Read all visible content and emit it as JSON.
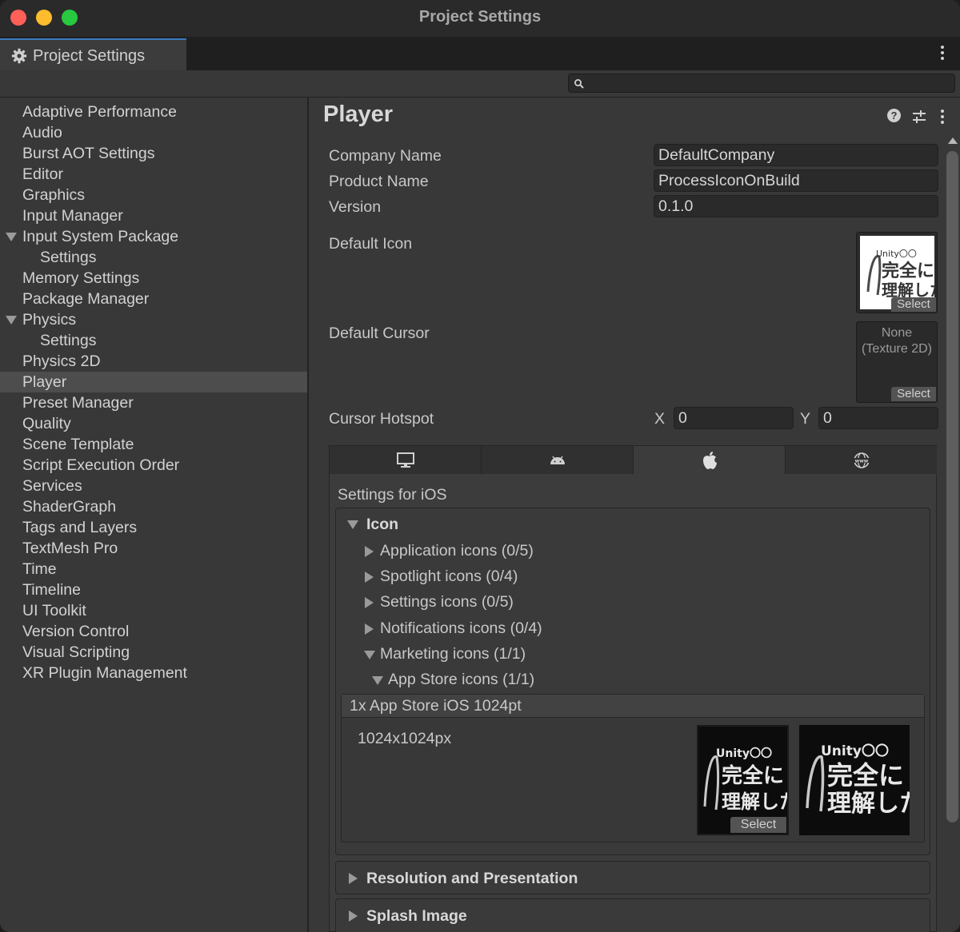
{
  "window": {
    "title": "Project Settings"
  },
  "tab": {
    "label": "Project Settings",
    "icon": "gear-icon"
  },
  "search": {
    "placeholder": ""
  },
  "sidebar": {
    "items": [
      {
        "label": "Adaptive Performance"
      },
      {
        "label": "Audio"
      },
      {
        "label": "Burst AOT Settings"
      },
      {
        "label": "Editor"
      },
      {
        "label": "Graphics"
      },
      {
        "label": "Input Manager"
      },
      {
        "label": "Input System Package"
      },
      {
        "label": "Settings"
      },
      {
        "label": "Memory Settings"
      },
      {
        "label": "Package Manager"
      },
      {
        "label": "Physics"
      },
      {
        "label": "Settings"
      },
      {
        "label": "Physics 2D"
      },
      {
        "label": "Player"
      },
      {
        "label": "Preset Manager"
      },
      {
        "label": "Quality"
      },
      {
        "label": "Scene Template"
      },
      {
        "label": "Script Execution Order"
      },
      {
        "label": "Services"
      },
      {
        "label": "ShaderGraph"
      },
      {
        "label": "Tags and Layers"
      },
      {
        "label": "TextMesh Pro"
      },
      {
        "label": "Time"
      },
      {
        "label": "Timeline"
      },
      {
        "label": "UI Toolkit"
      },
      {
        "label": "Version Control"
      },
      {
        "label": "Visual Scripting"
      },
      {
        "label": "XR Plugin Management"
      }
    ],
    "selected": "Player"
  },
  "player": {
    "title": "Player",
    "company_name": {
      "label": "Company Name",
      "value": "DefaultCompany"
    },
    "product_name": {
      "label": "Product Name",
      "value": "ProcessIconOnBuild"
    },
    "version": {
      "label": "Version",
      "value": "0.1.0"
    },
    "default_icon": {
      "label": "Default Icon",
      "select": "Select",
      "art": {
        "line1": "Unity〇〇",
        "line2": "完全に",
        "line3": "理解した"
      }
    },
    "default_cursor": {
      "label": "Default Cursor",
      "none_line1": "None",
      "none_line2": "(Texture 2D)",
      "select": "Select"
    },
    "cursor_hotspot": {
      "label": "Cursor Hotspot",
      "x_label": "X",
      "x": "0",
      "y_label": "Y",
      "y": "0"
    }
  },
  "platform_tabs": [
    "desktop-icon",
    "android-icon",
    "apple-icon",
    "webgl-icon"
  ],
  "active_platform": "apple-icon",
  "ios": {
    "title": "Settings for iOS",
    "icon_section": {
      "title": "Icon",
      "rows": [
        {
          "label": "Application icons (0/5)"
        },
        {
          "label": "Spotlight icons (0/4)"
        },
        {
          "label": "Settings icons (0/5)"
        },
        {
          "label": "Notifications icons (0/4)"
        },
        {
          "label": "Marketing icons (1/1)"
        },
        {
          "label": "App Store icons (1/1)"
        }
      ],
      "appstore": {
        "title": "1x App Store iOS 1024pt",
        "size": "1024x1024px",
        "select": "Select"
      }
    },
    "resolution": {
      "title": "Resolution and Presentation"
    },
    "splash": {
      "title": "Splash Image"
    }
  }
}
